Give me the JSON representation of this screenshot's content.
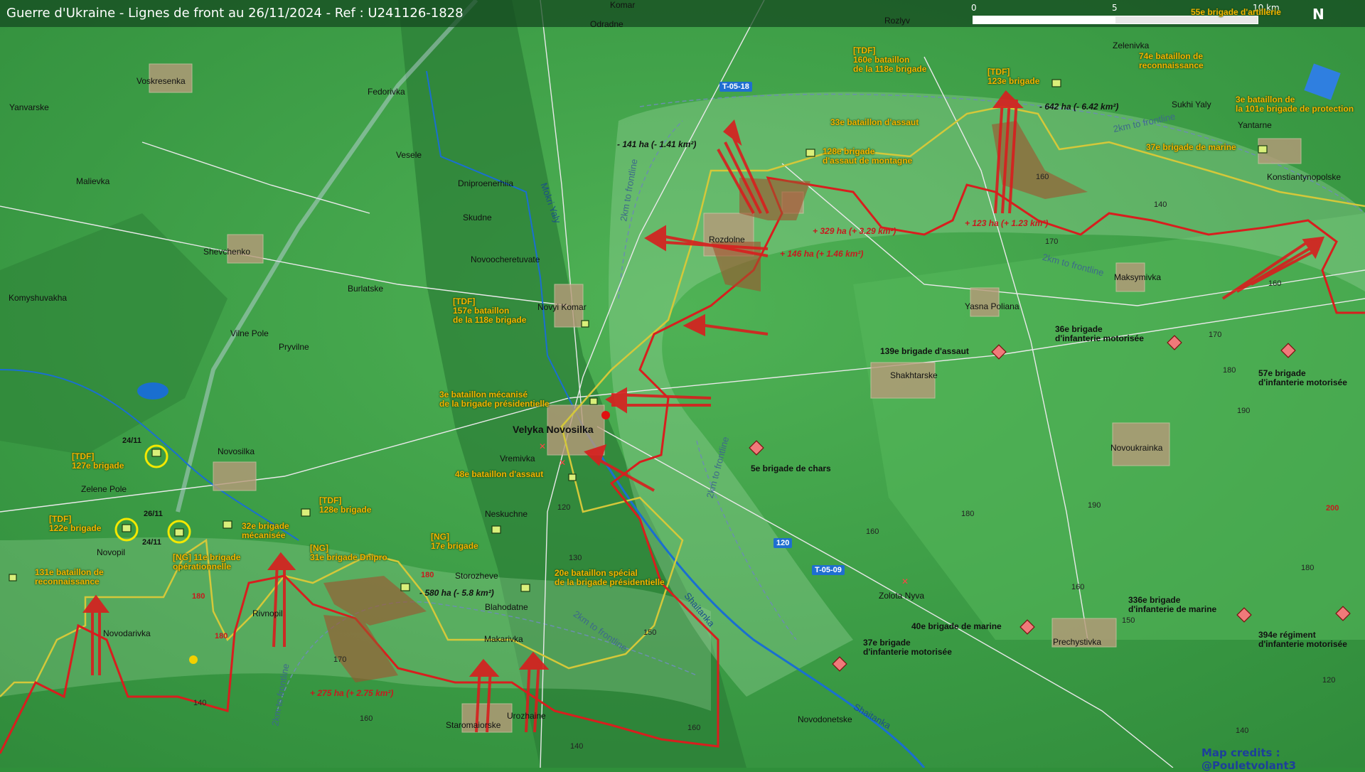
{
  "header": {
    "title": "Guerre d'Ukraine - Lignes de front au 26/11/2024 - Ref : U241126-1828",
    "scale_labels": [
      "0",
      "5",
      "10 km"
    ],
    "north": "N"
  },
  "credits": "Map credits : @Pouletvolant3",
  "colors": {
    "ukraine_line": "#d4c83a",
    "russia_line": "#d81e1e",
    "gain_fill": "#a0522d",
    "buffer": "#7aa7c7",
    "unit_ua": "#f3b200",
    "unit_ru": "#f07a7a"
  },
  "places": [
    "Komar",
    "Odradne",
    "Rozlyv",
    "Zelenivka",
    "Voskresenka",
    "Yanvarske",
    "Fedorivka",
    "Vesele",
    "Malievka",
    "Dniproenerhiia",
    "Skudne",
    "Shevchenko",
    "Novoocheretuvate",
    "Burlatske",
    "Komyshuvakha",
    "Novyi Komar",
    "Rozdolne",
    "Yasna Poliana",
    "Maksymivka",
    "Sukhi Yaly",
    "Yantarne",
    "Konstiantynopolske",
    "Vilne Pole",
    "Pryvilne",
    "Shakhtarske",
    "Novoukrainka",
    "Novosilka",
    "Vremivka",
    "Zelene Pole",
    "Neskuchne",
    "Novopil",
    "Storozheve",
    "Blahodatne",
    "Rivnopil",
    "Makarivka",
    "Novodarivka",
    "Staromaiorske",
    "Urozhaine",
    "Zolota Nyva",
    "Prechystivka",
    "Novodonetske"
  ],
  "main_town": "Velyka Novosilka",
  "rivers": [
    "Mokri Yaly",
    "Shaitanka"
  ],
  "roads": [
    "T-05-18",
    "T-05-09",
    "120"
  ],
  "buffer_label": "2km to frontline",
  "units_ua": [
    {
      "l1": "[TDF]",
      "l2": "160e bataillon",
      "l3": "de la 118e brigade"
    },
    {
      "l1": "[TDF]",
      "l2": "123e brigade"
    },
    {
      "l1": "74e bataillon de",
      "l2": "reconnaissance"
    },
    {
      "l1": "3e bataillon de",
      "l2": "la 101e brigade de protection"
    },
    {
      "l1": "33e bataillon d'assaut"
    },
    {
      "l1": "128e brigade",
      "l2": "d'assaut de montagne"
    },
    {
      "l1": "37e brigade de marine"
    },
    {
      "l1": "[TDF]",
      "l2": "157e bataillon",
      "l3": "de la 118e brigade"
    },
    {
      "l1": "3e bataillon mécanisé",
      "l2": "de la brigade présidentielle"
    },
    {
      "l1": "48e bataillon d'assaut"
    },
    {
      "l1": "[TDF]",
      "l2": "127e brigade"
    },
    {
      "l1": "[TDF]",
      "l2": "122e brigade"
    },
    {
      "l1": "[TDF]",
      "l2": "128e brigade"
    },
    {
      "l1": "32e brigade",
      "l2": "mécanisée"
    },
    {
      "l1": "[NG] 11e brigade",
      "l2": "opérationnelle"
    },
    {
      "l1": "[NG]",
      "l2": "31e brigade Dnipro"
    },
    {
      "l1": "[NG]",
      "l2": "17e brigade"
    },
    {
      "l1": "131e bataillon de",
      "l2": "reconnaissance"
    },
    {
      "l1": "20e bataillon spécial",
      "l2": "de la brigade présidentielle"
    },
    {
      "l1": "55e brigade d'artillerie"
    }
  ],
  "units_ru": [
    {
      "l1": "139e brigade d'assaut"
    },
    {
      "l1": "36e brigade",
      "l2": "d'infanterie motorisée"
    },
    {
      "l1": "57e brigade",
      "l2": "d'infanterie motorisée"
    },
    {
      "l1": "5e brigade de chars"
    },
    {
      "l1": "336e brigade",
      "l2": "d'infanterie de marine"
    },
    {
      "l1": "40e brigade de marine"
    },
    {
      "l1": "37e brigade",
      "l2": "d'infanterie motorisée"
    },
    {
      "l1": "394e régiment",
      "l2": "d'infanterie motorisée"
    }
  ],
  "changes": {
    "loss_141": "- 141 ha (- 1.41 km²)",
    "loss_642": "- 642 ha (- 6.42 km²)",
    "gain_329": "+ 329 ha (+ 3.29 km²)",
    "gain_146": "+ 146 ha (+ 1.46 km²)",
    "gain_123": "+ 123 ha (+ 1.23 km²)",
    "loss_580": "- 580 ha (- 5.8 km²)",
    "gain_275": "+ 275 ha (+ 2.75 km²)"
  },
  "dates": [
    "24/11",
    "26/11",
    "24/11"
  ],
  "elevations": [
    "160",
    "140",
    "170",
    "160",
    "170",
    "180",
    "190",
    "120",
    "130",
    "150",
    "160",
    "180",
    "190",
    "160",
    "180",
    "150",
    "140",
    "120",
    "140",
    "160",
    "170",
    "160",
    "140",
    "200",
    "180",
    "180",
    "180"
  ]
}
